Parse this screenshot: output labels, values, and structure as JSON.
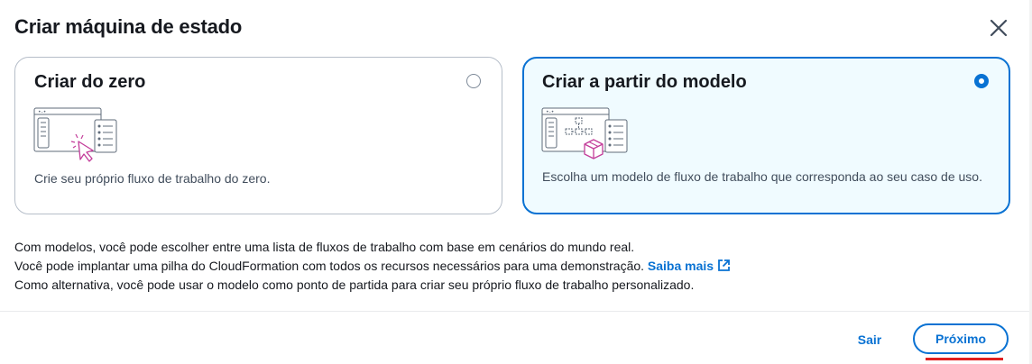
{
  "modal": {
    "title": "Criar máquina de estado",
    "close_icon": "close-icon"
  },
  "options": [
    {
      "title": "Criar do zero",
      "description": "Crie seu próprio fluxo de trabalho do zero.",
      "selected": false,
      "illustration": "blank-workflow-cursor-illustration"
    },
    {
      "title": "Criar a partir do modelo",
      "description": "Escolha um modelo de fluxo de trabalho que corresponda ao seu caso de uso.",
      "selected": true,
      "illustration": "template-workflow-box-illustration"
    }
  ],
  "info": {
    "line1": "Com modelos, você pode escolher entre uma lista de fluxos de trabalho com base em cenários do mundo real.",
    "line2": "Você pode implantar uma pilha do CloudFormation com todos os recursos necessários para uma demonstração.",
    "link_label": "Saiba mais",
    "link_icon": "external-link-icon",
    "line3": "Como alternativa, você pode usar o modelo como ponto de partida para criar seu próprio fluxo de trabalho personalizado."
  },
  "footer": {
    "exit_label": "Sair",
    "next_label": "Próximo"
  },
  "colors": {
    "accent": "#0972d3",
    "selected_bg": "#f0fbff",
    "illustration_accent": "#c33d9a",
    "text": "#16191f"
  }
}
